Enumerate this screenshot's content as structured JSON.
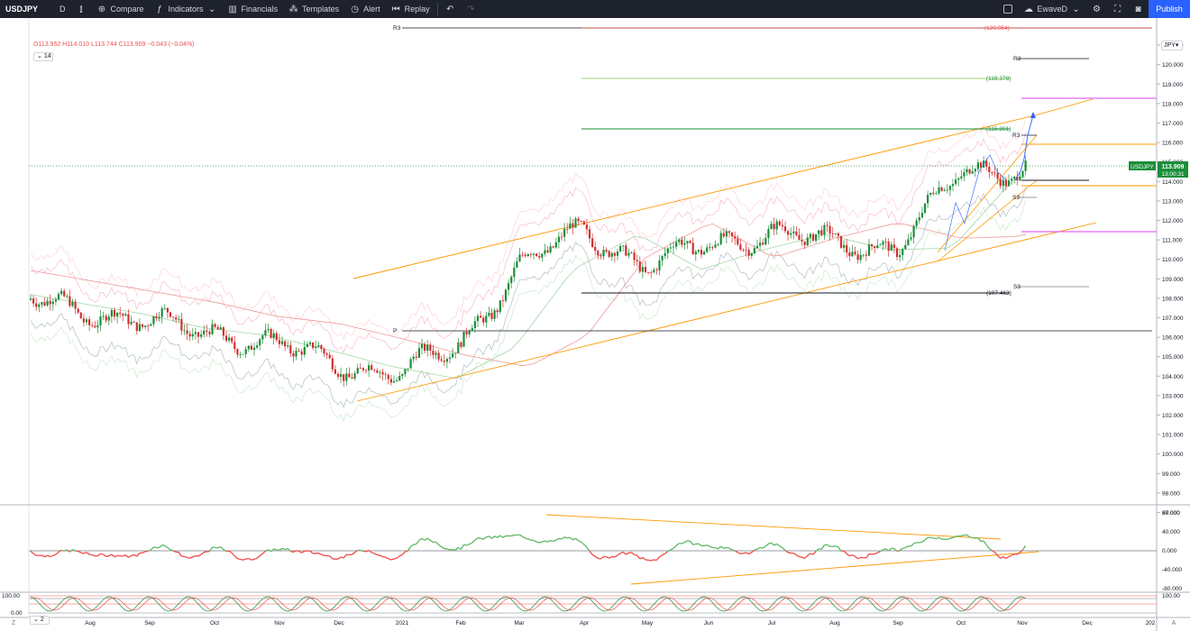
{
  "toolbar": {
    "symbol": "USDJPY",
    "interval": "D",
    "compare": "Compare",
    "indicators": "Indicators",
    "financials": "Financials",
    "templates": "Templates",
    "alert": "Alert",
    "replay": "Replay",
    "layout_name": "EwaveD",
    "publish": "Publish"
  },
  "legend": {
    "ohlc": "O113.952 H114.010 L113.744 C113.909 −0.043 (−0.04%)",
    "period": "14",
    "period2": "2"
  },
  "price_axis": {
    "currency": "JPY",
    "ticks": [
      "121.000",
      "120.000",
      "119.000",
      "118.000",
      "117.000",
      "116.000",
      "115.000",
      "114.000",
      "113.000",
      "112.000",
      "111.000",
      "110.000",
      "109.000",
      "108.000",
      "107.000",
      "106.000",
      "105.000",
      "104.000",
      "103.000",
      "102.000",
      "101.000",
      "100.000",
      "99.000",
      "98.000",
      "97.000"
    ],
    "symbol_label": "USDJPY",
    "last_price": "113.909",
    "countdown": "13:00:31"
  },
  "osc_axis": {
    "ticks": [
      "80.000",
      "40.000",
      "0.000",
      "-40.000",
      "-80.000"
    ]
  },
  "stoch_axis": {
    "top_left": "100.00",
    "bottom_left": "0.00",
    "top_right": "100.00"
  },
  "time_axis": {
    "labels": [
      "Aug",
      "Sep",
      "Oct",
      "Nov",
      "Dec",
      "2021",
      "Feb",
      "Mar",
      "Apr",
      "May",
      "Jun",
      "Jul",
      "Aug",
      "Sep",
      "Oct",
      "Nov",
      "Dec",
      "202"
    ]
  },
  "annotations": {
    "r3_left": "R3",
    "r3_value": "(120.954)",
    "r3_right": "R3",
    "target_118": "(118.378)",
    "target_115": "(115.801)",
    "r3_small": "R3",
    "s3_small": "S3",
    "pivot": "P",
    "s3_lower": "S3",
    "low_107": "(107.463)"
  },
  "colors": {
    "up": "#26a69a",
    "down": "#ef5350",
    "up_candle": "#1b8e3a",
    "down_candle": "#d32f2f",
    "channel": "#ff9800",
    "pivot_red": "#ef5350",
    "magenta": "#e040fb",
    "accent": "#2962ff"
  },
  "chart_data": {
    "type": "line",
    "title": "USDJPY",
    "x": [
      "Aug",
      "Sep",
      "Oct",
      "Nov",
      "Dec",
      "2021",
      "Feb",
      "Mar",
      "Apr",
      "May",
      "Jun",
      "Jul",
      "Aug",
      "Sep",
      "Oct",
      "Nov"
    ],
    "series": [
      {
        "name": "USDJPY",
        "values": [
          106.5,
          105.8,
          105.4,
          104.6,
          103.8,
          103.2,
          104.8,
          108.8,
          110.6,
          108.8,
          109.8,
          110.6,
          109.8,
          109.9,
          113.5,
          113.9
        ]
      }
    ],
    "ylim": [
      96.5,
      121.5
    ]
  }
}
